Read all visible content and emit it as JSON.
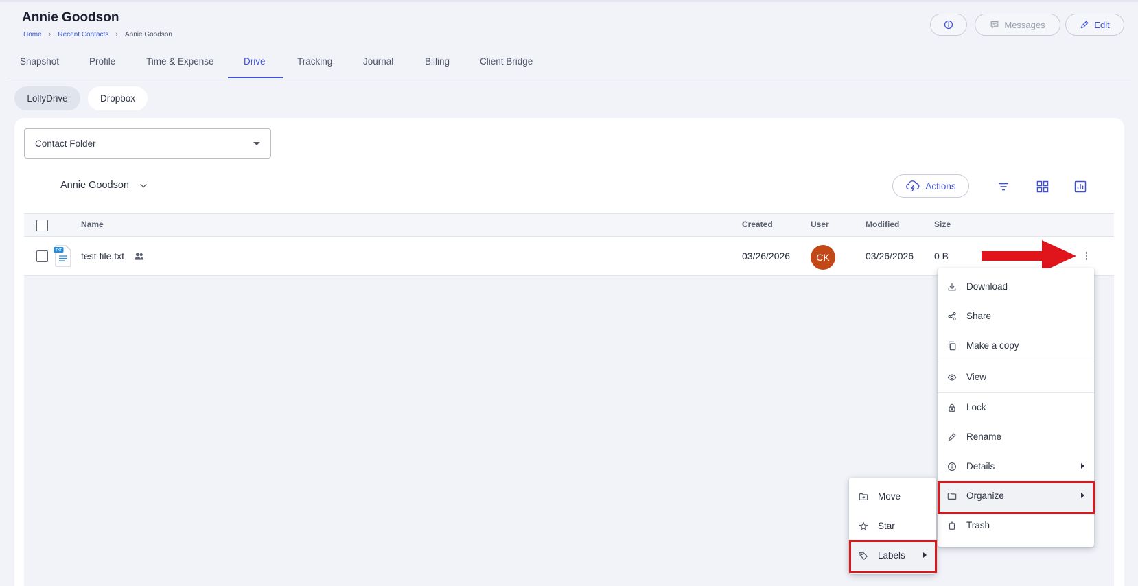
{
  "header": {
    "title": "Annie Goodson",
    "breadcrumbs": [
      "Home",
      "Recent Contacts",
      "Annie Goodson"
    ],
    "buttons": {
      "info_icon": "info-circle-icon",
      "messages": "Messages",
      "edit": "Edit"
    }
  },
  "tabs": [
    "Snapshot",
    "Profile",
    "Time & Expense",
    "Drive",
    "Tracking",
    "Journal",
    "Billing",
    "Client Bridge"
  ],
  "active_tab": "Drive",
  "storage_tabs": [
    "LollyDrive",
    "Dropbox"
  ],
  "active_storage": "LollyDrive",
  "folder_select": {
    "value": "Contact Folder"
  },
  "current_folder": "Annie Goodson",
  "toolbar": {
    "actions": "Actions"
  },
  "table": {
    "columns": {
      "name": "Name",
      "created": "Created",
      "user": "User",
      "modified": "Modified",
      "size": "Size"
    },
    "rows": [
      {
        "name": "test file.txt",
        "created": "03/26/2026",
        "user_initials": "CK",
        "modified": "03/26/2026",
        "size": "0 B"
      }
    ]
  },
  "context_menu": {
    "items": [
      "Download",
      "Share",
      "Make a copy",
      "View",
      "Lock",
      "Rename",
      "Details",
      "Organize",
      "Trash"
    ],
    "highlighted": "Organize"
  },
  "organize_submenu": {
    "items": [
      "Move",
      "Star",
      "Labels"
    ],
    "highlighted": "Labels"
  },
  "colors": {
    "accent": "#3f4fd6",
    "avatar": "#c24817",
    "annotation_red": "#e0141b"
  }
}
